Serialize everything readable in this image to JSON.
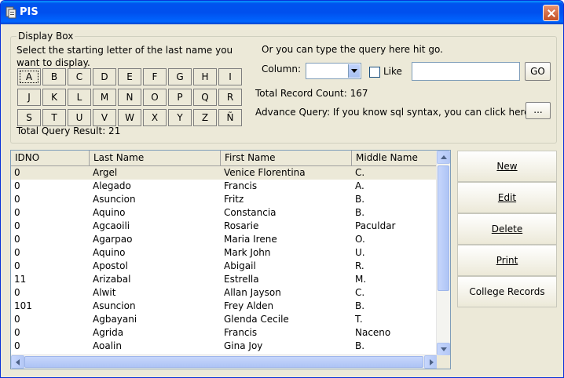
{
  "window": {
    "title": "PIS"
  },
  "display_box": {
    "legend": "Display Box",
    "instruction": "Select the starting letter of the last name you want to display.",
    "letters": [
      "A",
      "B",
      "C",
      "D",
      "E",
      "F",
      "G",
      "H",
      "I",
      "J",
      "K",
      "L",
      "M",
      "N",
      "O",
      "P",
      "Q",
      "R",
      "S",
      "T",
      "U",
      "V",
      "W",
      "X",
      "Y",
      "Z",
      "Ñ"
    ],
    "selected_letter": "A",
    "total_query_result": "Total Query Result: 21"
  },
  "query": {
    "or_type_text": "Or you can type the query here hit go.",
    "column_label": "Column:",
    "column_value": "",
    "like_label": "Like",
    "like_checked": false,
    "query_value": "",
    "go_label": "GO",
    "total_record_count": "Total Record Count: 167",
    "advance_query_text": "Advance Query: If you know sql syntax, you can click here.",
    "advance_button_label": "..."
  },
  "table": {
    "columns": [
      "IDNO",
      "Last Name",
      "First Name",
      "Middle Name"
    ],
    "rows": [
      [
        "0",
        "Argel",
        "Venice Florentina",
        "C."
      ],
      [
        "0",
        "Alegado",
        "Francis",
        "A."
      ],
      [
        "0",
        "Asuncion",
        "Fritz",
        "B."
      ],
      [
        "0",
        "Aquino",
        "Constancia",
        "B."
      ],
      [
        "0",
        "Agcaoili",
        "Rosarie",
        "Paculdar"
      ],
      [
        "0",
        "Agarpao",
        "Maria Irene",
        "O."
      ],
      [
        "0",
        "Aquino",
        "Mark John",
        "U."
      ],
      [
        "0",
        "Apostol",
        "Abigail",
        "R."
      ],
      [
        "11",
        "Arizabal",
        "Estrella",
        "M."
      ],
      [
        "0",
        "Alwit",
        "Allan Jayson",
        "C."
      ],
      [
        "101",
        "Asuncion",
        "Frey Alden",
        "B."
      ],
      [
        "0",
        "Agbayani",
        "Glenda Cecile",
        "T."
      ],
      [
        "0",
        "Agrida",
        "Francis",
        "Naceno"
      ],
      [
        "0",
        "Aoalin",
        "Gina Joy",
        "B."
      ]
    ]
  },
  "side_buttons": {
    "new": "New",
    "edit": "Edit",
    "delete": "Delete",
    "print": "Print",
    "college_records": "College Records"
  }
}
